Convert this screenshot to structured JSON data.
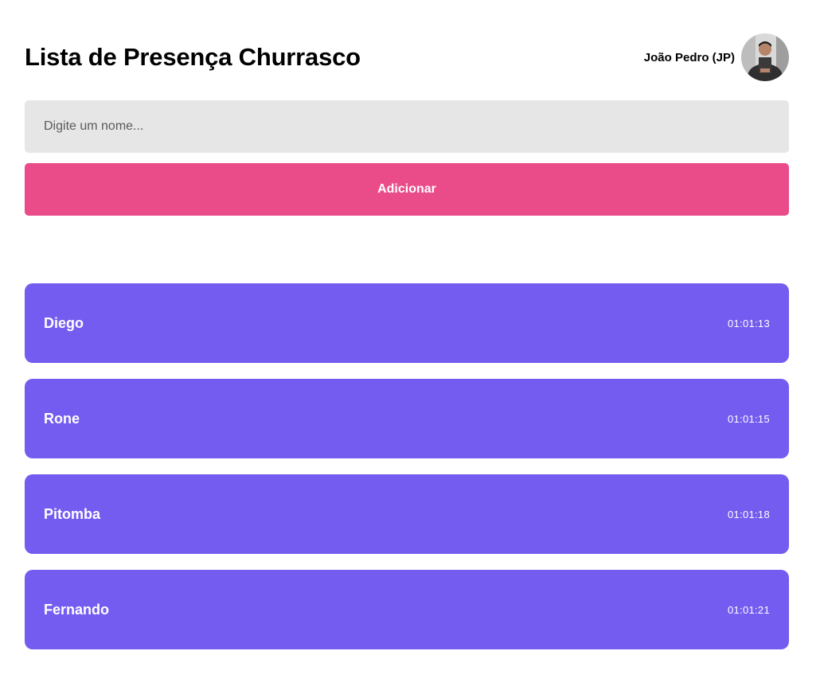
{
  "header": {
    "title": "Lista de Presença Churrasco",
    "user_name": "João Pedro (JP)",
    "avatar_icon": "user-avatar-photo"
  },
  "form": {
    "placeholder": "Digite um nome...",
    "value": "",
    "add_label": "Adicionar"
  },
  "colors": {
    "accent_button": "#ea4c89",
    "card_background": "#735cef",
    "input_background": "#e6e6e6"
  },
  "students": [
    {
      "name": "Diego",
      "time": "01:01:13"
    },
    {
      "name": "Rone",
      "time": "01:01:15"
    },
    {
      "name": "Pitomba",
      "time": "01:01:18"
    },
    {
      "name": "Fernando",
      "time": "01:01:21"
    }
  ]
}
